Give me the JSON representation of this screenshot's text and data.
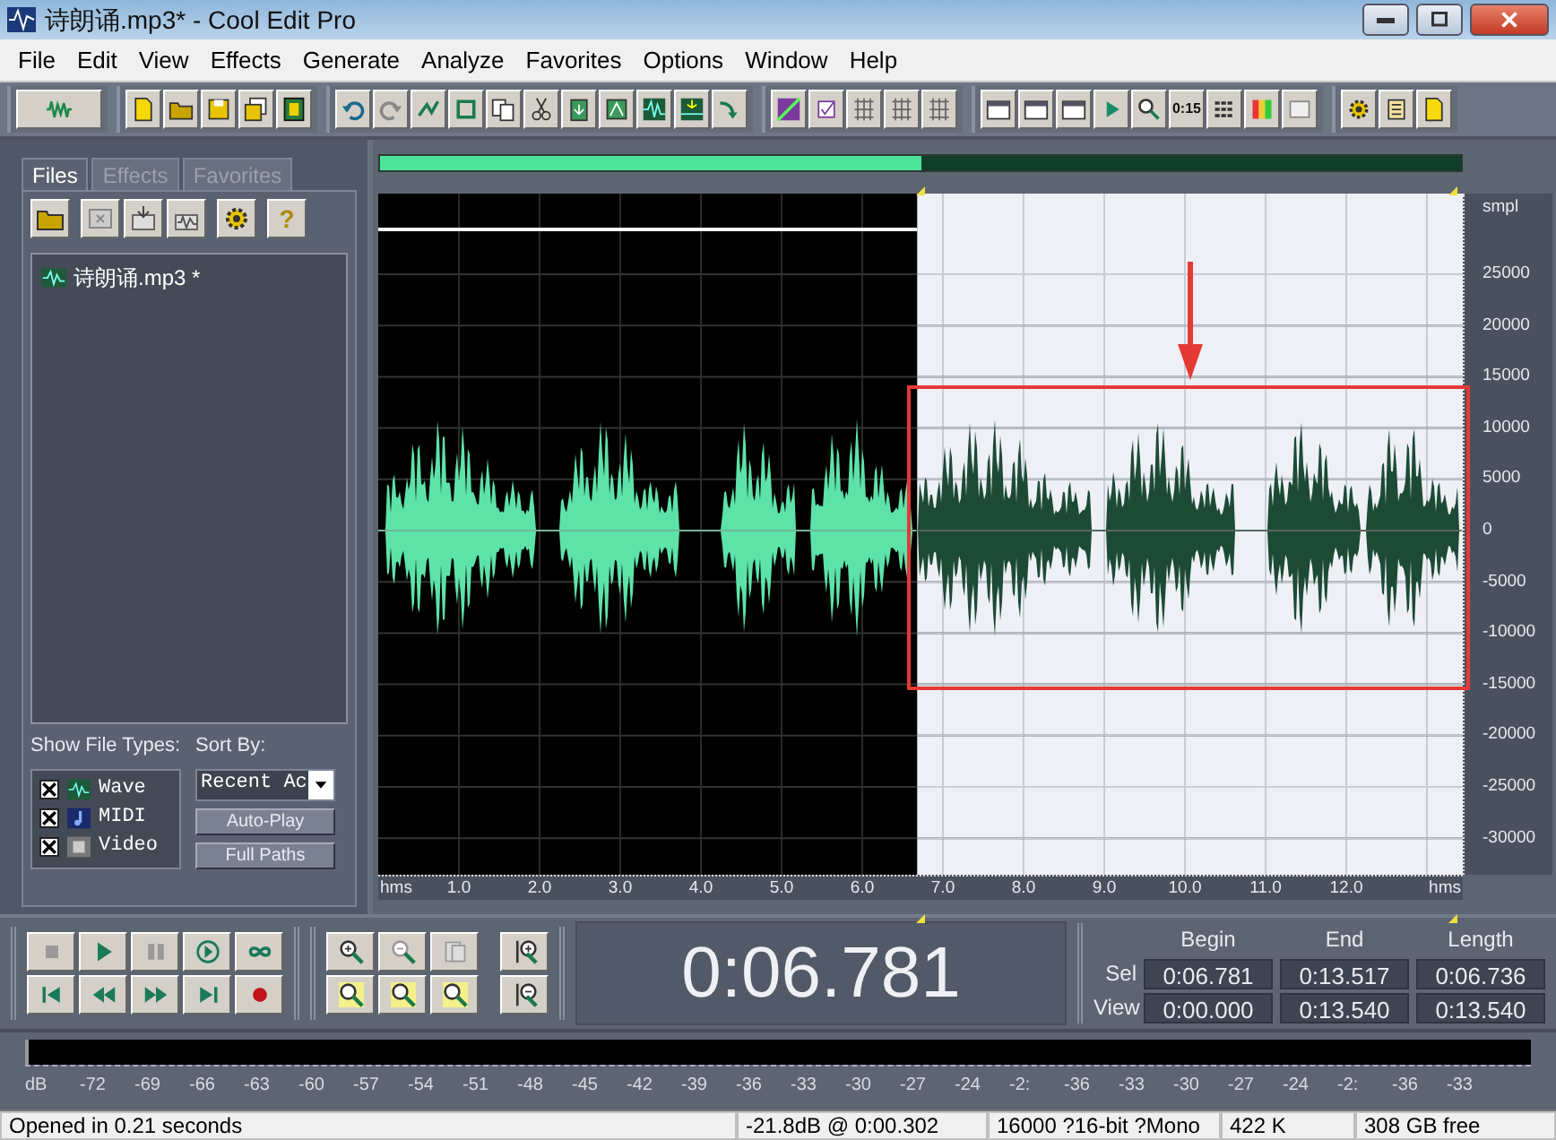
{
  "window": {
    "title": "诗朗诵.mp3* - Cool Edit Pro"
  },
  "menu": [
    "File",
    "Edit",
    "View",
    "Effects",
    "Generate",
    "Analyze",
    "Favorites",
    "Options",
    "Window",
    "Help"
  ],
  "toolbar": {
    "time_button_label": "0:15"
  },
  "organizer": {
    "tabs": [
      {
        "label": "Files",
        "selected": true
      },
      {
        "label": "Effects",
        "selected": false
      },
      {
        "label": "Favorites",
        "selected": false
      }
    ],
    "help_label": "?",
    "files": [
      {
        "name": "诗朗诵.mp3 *"
      }
    ],
    "show_file_types_label": "Show File Types:",
    "file_types": [
      {
        "label": "Wave",
        "checked": true,
        "kind": "wave"
      },
      {
        "label": "MIDI",
        "checked": true,
        "kind": "midi"
      },
      {
        "label": "Video",
        "checked": true,
        "kind": "video"
      }
    ],
    "sort_by_label": "Sort By:",
    "sort_by": {
      "value": "Recent Ac"
    },
    "buttons": [
      "Auto-Play",
      "Full Paths"
    ]
  },
  "overview": {
    "level": 0.5
  },
  "waveform": {
    "selection_start": {
      "level": 0.497
    }
  },
  "time_ruler": {
    "labels": [
      "hms",
      "1.0",
      "2.0",
      "3.0",
      "4.0",
      "5.0",
      "6.0",
      "7.0",
      "8.0",
      "9.0",
      "10.0",
      "11.0",
      "12.0",
      "hms"
    ]
  },
  "amplitude_axis": {
    "unit": "smpl",
    "labels": [
      "25000",
      "20000",
      "15000",
      "10000",
      "5000",
      "0",
      "-5000",
      "-10000",
      "-15000",
      "-20000",
      "-25000",
      "-30000"
    ]
  },
  "time_display": "0:06.781",
  "selection_info": {
    "columns": [
      "Begin",
      "End",
      "Length"
    ],
    "rows": [
      {
        "label": "Sel",
        "values": [
          "0:06.781",
          "0:13.517",
          "0:06.736"
        ]
      },
      {
        "label": "View",
        "values": [
          "0:00.000",
          "0:13.540",
          "0:13.540"
        ]
      }
    ]
  },
  "level_meter": {
    "labels": [
      "dB",
      "-72",
      "-69",
      "-66",
      "-63",
      "-60",
      "-57",
      "-54",
      "-51",
      "-48",
      "-45",
      "-42",
      "-39",
      "-36",
      "-33",
      "-30",
      "-27",
      "-24",
      "-2:",
      "-36",
      "-33",
      "-30",
      "-27",
      "-24",
      "-2:",
      "-36",
      "-33"
    ]
  },
  "status_bar": [
    "Opened in 0.21 seconds",
    "-21.8dB @ 0:00.302",
    "16000 ?16-bit ?Mono",
    "422 K",
    "308 GB free"
  ]
}
